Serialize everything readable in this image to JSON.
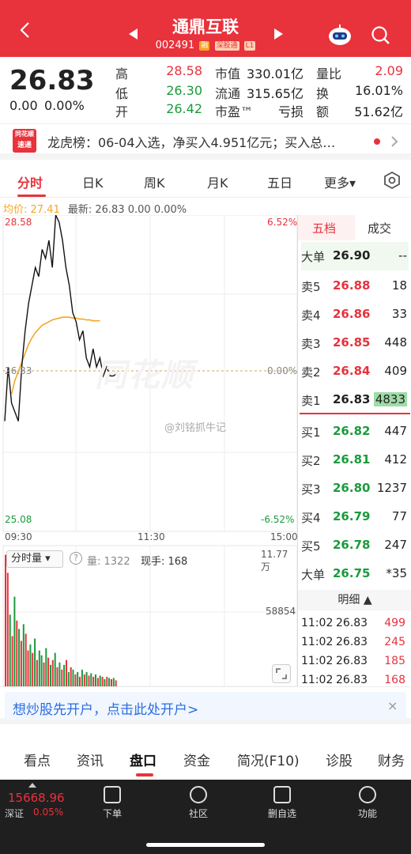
{
  "header": {
    "title": "通鼎互联",
    "code": "002491",
    "tags": [
      "融",
      "深股通",
      "L1"
    ],
    "colors": {
      "bar": "#e8323c",
      "up": "#e8323c",
      "down": "#1a9b3c"
    }
  },
  "quote": {
    "price": "26.83",
    "change": "0.00",
    "change_pct": "0.00%",
    "high_label": "高",
    "high": "28.58",
    "low_label": "低",
    "low": "26.30",
    "open_label": "开",
    "open": "26.42",
    "mktcap_label": "市值",
    "mktcap": "330.01亿",
    "float_label": "流通",
    "float": "315.65亿",
    "pe_label": "市盈™",
    "pe": "亏损",
    "volratio_label": "量比",
    "volratio": "2.09",
    "turnover_label": "换",
    "turnover": "16.01%",
    "amount_label": "额",
    "amount": "51.62亿"
  },
  "news": {
    "logo_top": "同花顺",
    "logo_bottom": "速递",
    "text": "龙虎榜：06-04入选，净买入4.951亿元；买入总…"
  },
  "period_tabs": [
    "分时",
    "日K",
    "周K",
    "月K",
    "五日",
    "更多▾"
  ],
  "info_line": {
    "avg": "均价: 27.41",
    "latest": "最新: 26.83  0.00  0.00%"
  },
  "chart_data": {
    "type": "line",
    "price_axis": {
      "top": "28.58",
      "mid": "26.83",
      "bottom": "25.08"
    },
    "pct_axis": {
      "top": "6.52%",
      "mid": "0.00%",
      "bottom": "-6.52%"
    },
    "time_labels": [
      "09:30",
      "11:30",
      "15:00"
    ],
    "ylim": [
      25.08,
      28.58
    ],
    "series": [
      {
        "values": [
          26.3,
          26.9,
          26.5,
          26.4,
          26.3,
          26.9,
          27.3,
          27.6,
          27.8,
          28.0,
          27.9,
          28.2,
          28.1,
          28.3,
          28.0,
          28.58,
          28.5,
          28.3,
          28.0,
          27.8,
          27.5,
          27.4,
          27.2,
          27.3,
          27.0,
          26.9,
          27.1,
          26.9,
          27.0,
          26.8,
          26.9,
          26.8,
          26.8,
          26.83
        ]
      },
      {
        "values": [
          26.6,
          26.75,
          26.85,
          26.95,
          27.05,
          27.15,
          27.22,
          27.28,
          27.32,
          27.36,
          27.38,
          27.4,
          27.42,
          27.43,
          27.44,
          27.45,
          27.45,
          27.45,
          27.44,
          27.44,
          27.43,
          27.43,
          27.42,
          27.42,
          27.41,
          27.41,
          27.41
        ]
      }
    ],
    "volume": {
      "label": "分时量 ▾",
      "qty_label": "量: 1322",
      "hand_label": "现手: 168",
      "max_label": "11.77万",
      "mid_label": "58854",
      "ylim": [
        0,
        117700
      ],
      "bars": [
        110,
        95,
        60,
        42,
        75,
        55,
        48,
        38,
        52,
        44,
        30,
        35,
        28,
        40,
        22,
        30,
        26,
        20,
        32,
        24,
        18,
        22,
        28,
        16,
        20,
        14,
        18,
        22,
        12,
        16,
        14,
        10,
        12,
        8,
        14,
        10,
        12,
        9,
        11,
        8,
        10,
        7,
        9,
        8,
        6,
        8,
        7,
        6,
        7,
        5
      ],
      "bar_colors": [
        "red",
        "red",
        "green",
        "red",
        "green",
        "red",
        "green",
        "red",
        "green",
        "red",
        "red",
        "green",
        "red",
        "green",
        "red",
        "green",
        "green",
        "red",
        "green",
        "red",
        "green",
        "red",
        "green",
        "red",
        "green",
        "red",
        "green",
        "red",
        "green",
        "red",
        "green",
        "red",
        "green",
        "red",
        "green",
        "red",
        "green",
        "red",
        "green",
        "red",
        "green",
        "red",
        "green",
        "red",
        "green",
        "red",
        "green",
        "red",
        "green",
        "red"
      ]
    }
  },
  "watermark": "同花顺",
  "credit": "@刘铭抓牛记",
  "book": {
    "tab_active": "五档",
    "tab_other": "成交",
    "big_sell": {
      "label": "大单",
      "price": "26.90",
      "vol": "--"
    },
    "sells": [
      {
        "label": "卖5",
        "price": "26.88",
        "vol": "18"
      },
      {
        "label": "卖4",
        "price": "26.86",
        "vol": "33"
      },
      {
        "label": "卖3",
        "price": "26.85",
        "vol": "448"
      },
      {
        "label": "卖2",
        "price": "26.84",
        "vol": "409"
      },
      {
        "label": "卖1",
        "price": "26.83",
        "vol": "4833"
      }
    ],
    "buys": [
      {
        "label": "买1",
        "price": "26.82",
        "vol": "447"
      },
      {
        "label": "买2",
        "price": "26.81",
        "vol": "412"
      },
      {
        "label": "买3",
        "price": "26.80",
        "vol": "1237"
      },
      {
        "label": "买4",
        "price": "26.79",
        "vol": "77"
      },
      {
        "label": "买5",
        "price": "26.78",
        "vol": "247"
      }
    ],
    "big_buy": {
      "label": "大单",
      "price": "26.75",
      "vol": "*35"
    },
    "detail_label": "明细 ▲",
    "ticks": [
      {
        "time": "11:02",
        "price": "26.83",
        "vol": "499"
      },
      {
        "time": "11:02",
        "price": "26.83",
        "vol": "245"
      },
      {
        "time": "11:02",
        "price": "26.83",
        "vol": "185"
      },
      {
        "time": "11:02",
        "price": "26.83",
        "vol": "168"
      }
    ]
  },
  "promo": {
    "text": "想炒股先开户，点击此处开户>",
    "close": "×"
  },
  "bottom_tabs": [
    "看点",
    "资讯",
    "盘口",
    "资金",
    "简况(F10)",
    "诊股",
    "财务"
  ],
  "dock": {
    "index_value": "15668.96",
    "index_name": "深证",
    "index_pct": "0.05%",
    "items": [
      "下单",
      "社区",
      "删自选",
      "功能"
    ]
  }
}
